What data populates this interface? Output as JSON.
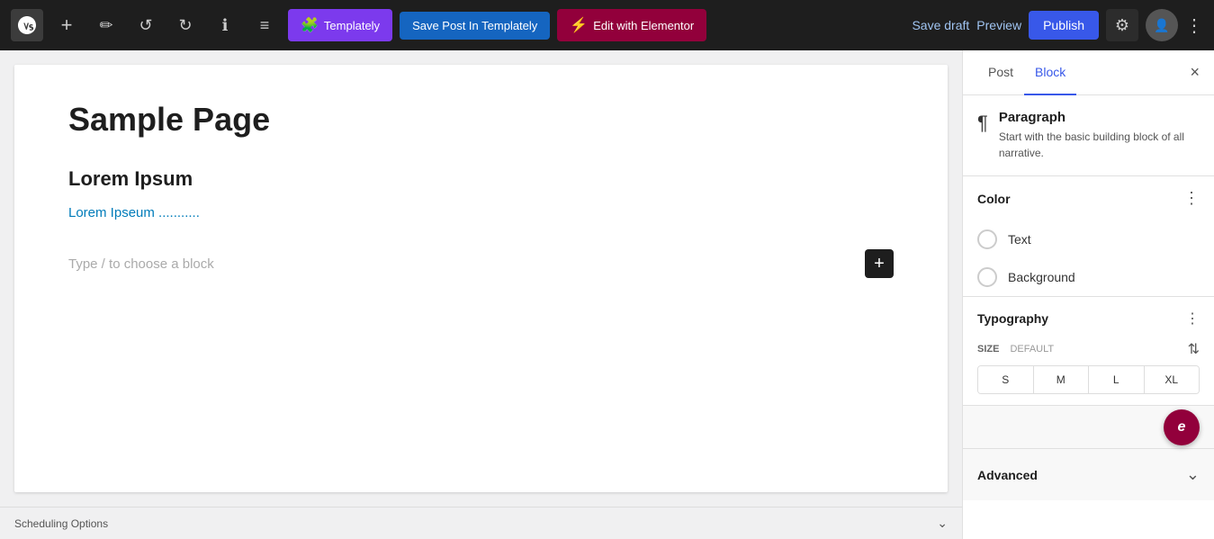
{
  "toolbar": {
    "wp_logo": "W",
    "add_label": "+",
    "pen_label": "✏",
    "undo_label": "↺",
    "redo_label": "↻",
    "info_label": "ℹ",
    "list_label": "≡",
    "templately_label": "Templately",
    "save_templately_label": "Save Post In Templately",
    "elementor_label": "Edit with Elementor",
    "save_draft_label": "Save draft",
    "preview_label": "Preview",
    "publish_label": "Publish",
    "settings_icon": "⚙",
    "avatar_icon": "👤",
    "more_icon": "⋮"
  },
  "editor": {
    "page_title": "Sample Page",
    "heading": "Lorem Ipsum",
    "link_text": "Lorem Ipseum ...........",
    "placeholder": "Type / to choose a block",
    "add_block_icon": "+"
  },
  "bottom_bar": {
    "scheduling_label": "Scheduling Options",
    "chevron_icon": "⌄"
  },
  "sidebar": {
    "tab_post": "Post",
    "tab_block": "Block",
    "close_icon": "×",
    "paragraph": {
      "icon": "¶",
      "title": "Paragraph",
      "description": "Start with the basic building block of all narrative."
    },
    "color": {
      "title": "Color",
      "more_icon": "⋮",
      "options": [
        {
          "label": "Text"
        },
        {
          "label": "Background"
        }
      ]
    },
    "typography": {
      "title": "Typography",
      "more_icon": "⋮",
      "filter_icon": "⇅",
      "size_label": "SIZE",
      "size_default": "DEFAULT",
      "size_options": [
        "S",
        "M",
        "L",
        "XL"
      ]
    },
    "advanced": {
      "title": "Advanced",
      "chevron_icon": "⌄"
    },
    "elementor_fab": "e"
  }
}
